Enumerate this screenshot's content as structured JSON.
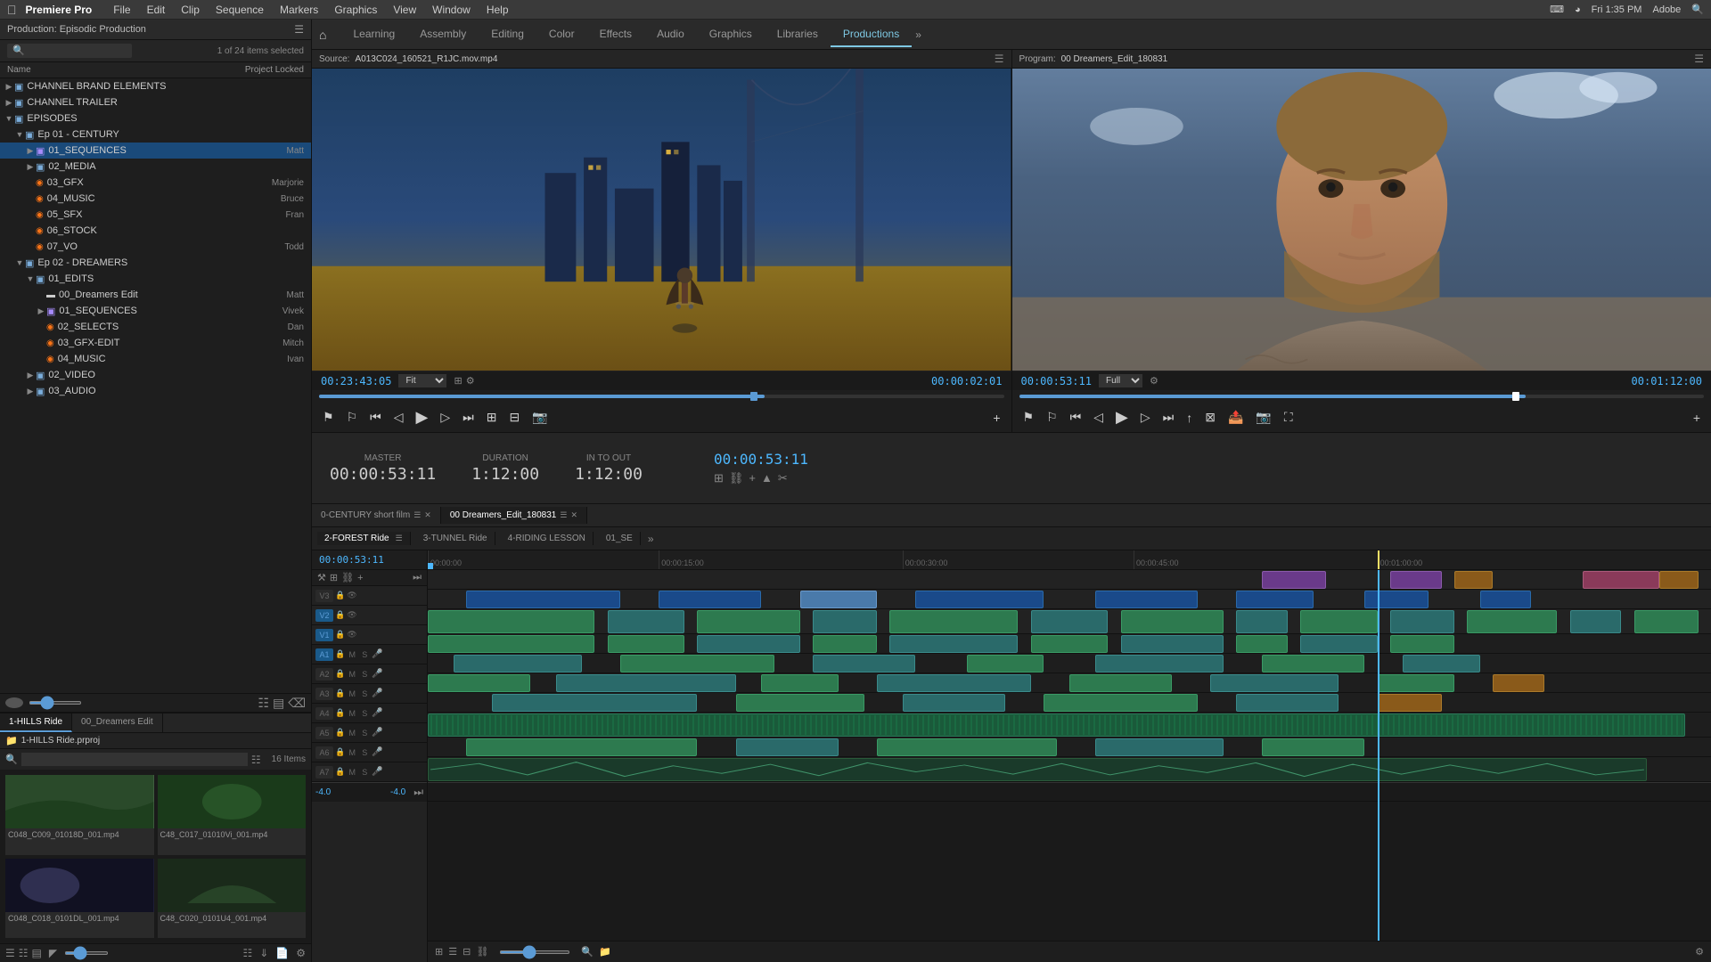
{
  "menubar": {
    "apple": "⌘",
    "app_name": "Premiere Pro",
    "menus": [
      "File",
      "Edit",
      "Clip",
      "Sequence",
      "Markers",
      "Graphics",
      "View",
      "Window",
      "Help"
    ],
    "right": {
      "time": "Fri 1:35 PM",
      "brand": "Adobe"
    }
  },
  "project": {
    "title": "Production: Episodic Production",
    "item_count": "1 of 24 items selected",
    "col_name": "Name",
    "col_locked": "Project Locked",
    "tree": [
      {
        "id": "channel-brand",
        "name": "CHANNEL BRAND ELEMENTS",
        "type": "bin",
        "indent": 0,
        "expanded": false
      },
      {
        "id": "channel-trailer",
        "name": "CHANNEL TRAILER",
        "type": "bin",
        "indent": 0,
        "expanded": false
      },
      {
        "id": "episodes",
        "name": "EPISODES",
        "type": "bin",
        "indent": 0,
        "expanded": true
      },
      {
        "id": "ep01",
        "name": "Ep 01 - CENTURY",
        "type": "bin",
        "indent": 1,
        "expanded": true
      },
      {
        "id": "01-sequences",
        "name": "01_SEQUENCES",
        "type": "bin-purple",
        "indent": 2,
        "expanded": false,
        "user": "Matt",
        "selected": true
      },
      {
        "id": "02-media",
        "name": "02_MEDIA",
        "type": "bin",
        "indent": 2,
        "expanded": false
      },
      {
        "id": "03-gfx",
        "name": "03_GFX",
        "type": "file",
        "indent": 2,
        "user": "Marjorie"
      },
      {
        "id": "04-music",
        "name": "04_MUSIC",
        "type": "file",
        "indent": 2,
        "user": "Bruce"
      },
      {
        "id": "05-sfx",
        "name": "05_SFX",
        "type": "file",
        "indent": 2,
        "user": "Fran"
      },
      {
        "id": "06-stock",
        "name": "06_STOCK",
        "type": "file",
        "indent": 2
      },
      {
        "id": "07-vo",
        "name": "07_VO",
        "type": "file",
        "indent": 2,
        "user": "Todd"
      },
      {
        "id": "ep02",
        "name": "Ep 02 - DREAMERS",
        "type": "bin",
        "indent": 1,
        "expanded": true
      },
      {
        "id": "01-edits",
        "name": "01_EDITS",
        "type": "bin",
        "indent": 2,
        "expanded": true
      },
      {
        "id": "dreamers-edit",
        "name": "00_Dreamers Edit",
        "type": "sequence",
        "indent": 3,
        "user": "Matt"
      },
      {
        "id": "01-seq2",
        "name": "01_SEQUENCES",
        "type": "bin-purple2",
        "indent": 3,
        "user": "Vivek"
      },
      {
        "id": "02-selects",
        "name": "02_SELECTS",
        "type": "file2",
        "indent": 3,
        "user": "Dan"
      },
      {
        "id": "03-gfx-edit",
        "name": "03_GFX-EDIT",
        "type": "file2",
        "indent": 3,
        "user": "Mitch"
      },
      {
        "id": "04-music2",
        "name": "04_MUSIC",
        "type": "file2",
        "indent": 3,
        "user": "Ivan"
      },
      {
        "id": "02-video",
        "name": "02_VIDEO",
        "type": "bin",
        "indent": 2,
        "expanded": false
      },
      {
        "id": "03-audio",
        "name": "03_AUDIO",
        "type": "bin",
        "indent": 2,
        "expanded": false
      }
    ]
  },
  "bottom_tabs": [
    {
      "id": "hills-ride",
      "label": "1-HILLS Ride",
      "active": true
    },
    {
      "id": "dreamers-edit-tab",
      "label": "00_Dreamers Edit",
      "active": false
    }
  ],
  "bin_label": "1-HILLS Ride.prproj",
  "bin_items": "16 Items",
  "thumbnails": [
    {
      "filename": "C048_C009_01018D_001.mp4",
      "color": "#3a5a3a"
    },
    {
      "filename": "C48_C017_01010Vi_001.mp4",
      "color": "#2a4a2a"
    },
    {
      "filename": "C048_C018_0101DL_001.mp4",
      "color": "#1a1a2a"
    },
    {
      "filename": "C48_C020_0101U4_001.mp4",
      "color": "#2a3a2a"
    }
  ],
  "top_nav": {
    "tabs": [
      {
        "id": "learning",
        "label": "Learning",
        "active": false
      },
      {
        "id": "assembly",
        "label": "Assembly",
        "active": false
      },
      {
        "id": "editing",
        "label": "Editing",
        "active": false
      },
      {
        "id": "color",
        "label": "Color",
        "active": false
      },
      {
        "id": "effects",
        "label": "Effects",
        "active": false
      },
      {
        "id": "audio",
        "label": "Audio",
        "active": false
      },
      {
        "id": "graphics",
        "label": "Graphics",
        "active": false
      },
      {
        "id": "libraries",
        "label": "Libraries",
        "active": false
      },
      {
        "id": "productions",
        "label": "Productions",
        "active": true
      }
    ]
  },
  "source_monitor": {
    "label": "Source:",
    "filename": "A013C024_160521_R1JC.mov.mp4",
    "timecode": "00:23:43:05",
    "zoom": "Fit",
    "duration": "00:00:02:01"
  },
  "program_monitor": {
    "label": "Program:",
    "filename": "00 Dreamers_Edit_180831",
    "timecode": "00:00:53:11",
    "zoom": "Full",
    "duration": "00:01:12:00"
  },
  "info_bar": {
    "master_label": "MASTER",
    "master_value": "00:00:53:11",
    "duration_label": "DURATION",
    "duration_value": "1:12:00",
    "in_to_out_label": "IN TO OUT",
    "in_to_out_value": "1:12:00",
    "timecode_value": "00:00:53:11"
  },
  "sequence_tabs": [
    {
      "id": "century-short",
      "label": "0-CENTURY short film",
      "active": false
    },
    {
      "id": "dreamers-edit-seq",
      "label": "00 Dreamers_Edit_180831",
      "active": true
    }
  ],
  "forest_tabs": [
    {
      "id": "forest-ride",
      "label": "2-FOREST Ride",
      "active": true
    },
    {
      "id": "tunnel-ride",
      "label": "3-TUNNEL Ride",
      "active": false
    },
    {
      "id": "riding-lesson",
      "label": "4-RIDING LESSON",
      "active": false
    },
    {
      "id": "seq-01",
      "label": "01_SE",
      "active": false
    }
  ],
  "timeline": {
    "tracks": {
      "video": [
        "V3",
        "V2",
        "V1"
      ],
      "audio": [
        "A1",
        "A2",
        "A3",
        "A4",
        "A5",
        "A6",
        "A7"
      ]
    },
    "timecodes": [
      "00:00:00",
      "00:00:15:00",
      "00:00:30:00",
      "00:00:45:00",
      "00:01:00:00"
    ],
    "playhead_pos": "00:00:53:11",
    "master_vol": "-4.0"
  }
}
